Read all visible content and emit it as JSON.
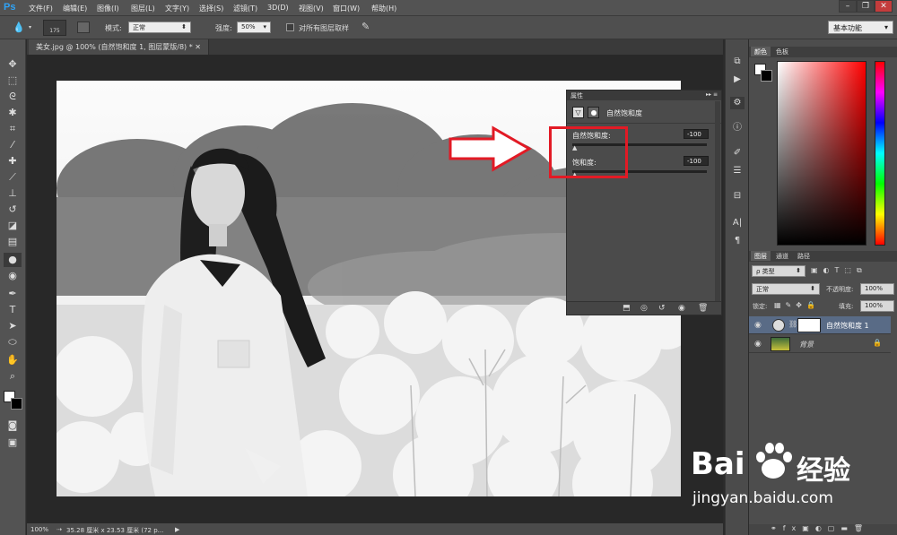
{
  "app": {
    "logo": "Ps"
  },
  "menu": [
    "文件(F)",
    "编辑(E)",
    "图像(I)",
    "图层(L)",
    "文字(Y)",
    "选择(S)",
    "滤镜(T)",
    "3D(D)",
    "视图(V)",
    "窗口(W)",
    "帮助(H)"
  ],
  "options": {
    "brush_size": "175",
    "mode_label": "模式:",
    "mode_value": "正常",
    "strength_label": "强度:",
    "strength_value": "50%",
    "sample_all_label": "对所有图层取样"
  },
  "workspace": "基本功能",
  "doc_tab": "美女.jpg @ 100% (自然饱和度 1, 图层蒙版/8) *",
  "status": {
    "zoom": "100%",
    "doc_info": "35.28 厘米 x 23.53 厘米 (72 p..."
  },
  "properties": {
    "title": "属性",
    "adjustment_name": "自然饱和度",
    "vibrance_label": "自然饱和度:",
    "vibrance_value": "-100",
    "saturation_label": "饱和度:",
    "saturation_value": "-100"
  },
  "color_panel": {
    "tabs": [
      "颜色",
      "色板"
    ]
  },
  "layers_panel": {
    "tabs": [
      "图层",
      "通道",
      "路径"
    ],
    "filter": "ρ 类型",
    "blend_mode": "正常",
    "opacity_label": "不透明度:",
    "opacity_value": "100%",
    "lock_label": "锁定:",
    "fill_label": "填充:",
    "fill_value": "100%",
    "layers": [
      {
        "name": "自然饱和度 1"
      },
      {
        "name": "背景"
      }
    ]
  },
  "watermark": {
    "brand": "Bai",
    "brand2": "经验",
    "url": "jingyan.baidu.com"
  },
  "colors": {
    "red_highlight": "#e21a25",
    "ps_blue": "#2fa3f6"
  }
}
